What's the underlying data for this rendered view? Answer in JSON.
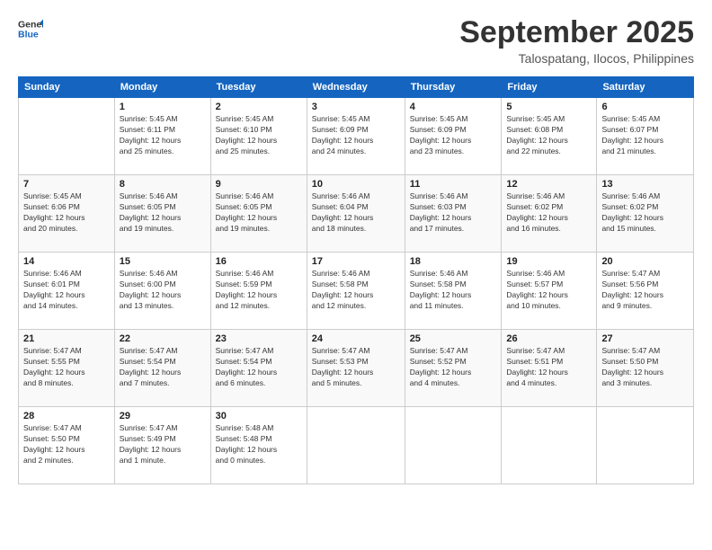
{
  "logo": {
    "line1": "General",
    "line2": "Blue"
  },
  "title": "September 2025",
  "subtitle": "Talospatang, Ilocos, Philippines",
  "weekdays": [
    "Sunday",
    "Monday",
    "Tuesday",
    "Wednesday",
    "Thursday",
    "Friday",
    "Saturday"
  ],
  "weeks": [
    [
      {
        "day": "",
        "info": ""
      },
      {
        "day": "1",
        "info": "Sunrise: 5:45 AM\nSunset: 6:11 PM\nDaylight: 12 hours\nand 25 minutes."
      },
      {
        "day": "2",
        "info": "Sunrise: 5:45 AM\nSunset: 6:10 PM\nDaylight: 12 hours\nand 25 minutes."
      },
      {
        "day": "3",
        "info": "Sunrise: 5:45 AM\nSunset: 6:09 PM\nDaylight: 12 hours\nand 24 minutes."
      },
      {
        "day": "4",
        "info": "Sunrise: 5:45 AM\nSunset: 6:09 PM\nDaylight: 12 hours\nand 23 minutes."
      },
      {
        "day": "5",
        "info": "Sunrise: 5:45 AM\nSunset: 6:08 PM\nDaylight: 12 hours\nand 22 minutes."
      },
      {
        "day": "6",
        "info": "Sunrise: 5:45 AM\nSunset: 6:07 PM\nDaylight: 12 hours\nand 21 minutes."
      }
    ],
    [
      {
        "day": "7",
        "info": "Sunrise: 5:45 AM\nSunset: 6:06 PM\nDaylight: 12 hours\nand 20 minutes."
      },
      {
        "day": "8",
        "info": "Sunrise: 5:46 AM\nSunset: 6:05 PM\nDaylight: 12 hours\nand 19 minutes."
      },
      {
        "day": "9",
        "info": "Sunrise: 5:46 AM\nSunset: 6:05 PM\nDaylight: 12 hours\nand 19 minutes."
      },
      {
        "day": "10",
        "info": "Sunrise: 5:46 AM\nSunset: 6:04 PM\nDaylight: 12 hours\nand 18 minutes."
      },
      {
        "day": "11",
        "info": "Sunrise: 5:46 AM\nSunset: 6:03 PM\nDaylight: 12 hours\nand 17 minutes."
      },
      {
        "day": "12",
        "info": "Sunrise: 5:46 AM\nSunset: 6:02 PM\nDaylight: 12 hours\nand 16 minutes."
      },
      {
        "day": "13",
        "info": "Sunrise: 5:46 AM\nSunset: 6:02 PM\nDaylight: 12 hours\nand 15 minutes."
      }
    ],
    [
      {
        "day": "14",
        "info": "Sunrise: 5:46 AM\nSunset: 6:01 PM\nDaylight: 12 hours\nand 14 minutes."
      },
      {
        "day": "15",
        "info": "Sunrise: 5:46 AM\nSunset: 6:00 PM\nDaylight: 12 hours\nand 13 minutes."
      },
      {
        "day": "16",
        "info": "Sunrise: 5:46 AM\nSunset: 5:59 PM\nDaylight: 12 hours\nand 12 minutes."
      },
      {
        "day": "17",
        "info": "Sunrise: 5:46 AM\nSunset: 5:58 PM\nDaylight: 12 hours\nand 12 minutes."
      },
      {
        "day": "18",
        "info": "Sunrise: 5:46 AM\nSunset: 5:58 PM\nDaylight: 12 hours\nand 11 minutes."
      },
      {
        "day": "19",
        "info": "Sunrise: 5:46 AM\nSunset: 5:57 PM\nDaylight: 12 hours\nand 10 minutes."
      },
      {
        "day": "20",
        "info": "Sunrise: 5:47 AM\nSunset: 5:56 PM\nDaylight: 12 hours\nand 9 minutes."
      }
    ],
    [
      {
        "day": "21",
        "info": "Sunrise: 5:47 AM\nSunset: 5:55 PM\nDaylight: 12 hours\nand 8 minutes."
      },
      {
        "day": "22",
        "info": "Sunrise: 5:47 AM\nSunset: 5:54 PM\nDaylight: 12 hours\nand 7 minutes."
      },
      {
        "day": "23",
        "info": "Sunrise: 5:47 AM\nSunset: 5:54 PM\nDaylight: 12 hours\nand 6 minutes."
      },
      {
        "day": "24",
        "info": "Sunrise: 5:47 AM\nSunset: 5:53 PM\nDaylight: 12 hours\nand 5 minutes."
      },
      {
        "day": "25",
        "info": "Sunrise: 5:47 AM\nSunset: 5:52 PM\nDaylight: 12 hours\nand 4 minutes."
      },
      {
        "day": "26",
        "info": "Sunrise: 5:47 AM\nSunset: 5:51 PM\nDaylight: 12 hours\nand 4 minutes."
      },
      {
        "day": "27",
        "info": "Sunrise: 5:47 AM\nSunset: 5:50 PM\nDaylight: 12 hours\nand 3 minutes."
      }
    ],
    [
      {
        "day": "28",
        "info": "Sunrise: 5:47 AM\nSunset: 5:50 PM\nDaylight: 12 hours\nand 2 minutes."
      },
      {
        "day": "29",
        "info": "Sunrise: 5:47 AM\nSunset: 5:49 PM\nDaylight: 12 hours\nand 1 minute."
      },
      {
        "day": "30",
        "info": "Sunrise: 5:48 AM\nSunset: 5:48 PM\nDaylight: 12 hours\nand 0 minutes."
      },
      {
        "day": "",
        "info": ""
      },
      {
        "day": "",
        "info": ""
      },
      {
        "day": "",
        "info": ""
      },
      {
        "day": "",
        "info": ""
      }
    ]
  ]
}
